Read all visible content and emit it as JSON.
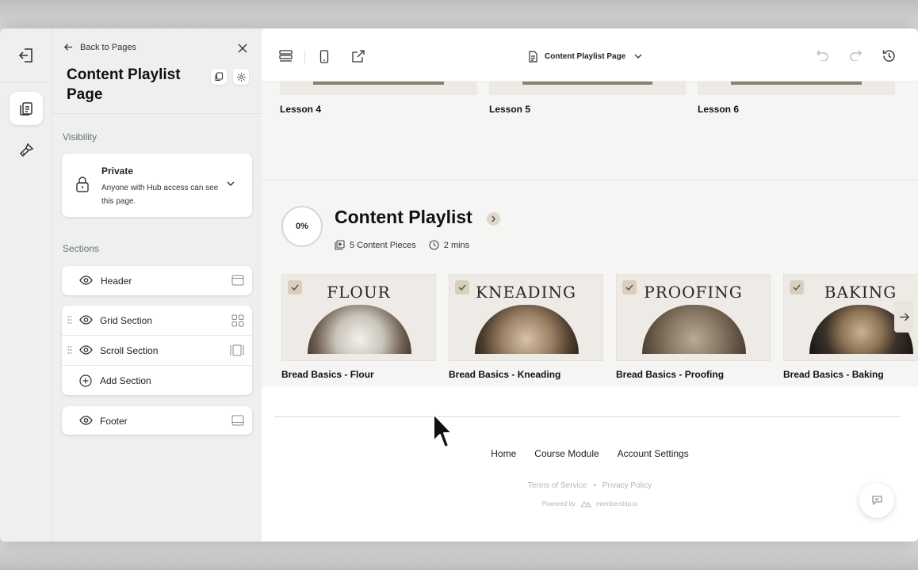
{
  "sidebar": {
    "back_label": "Back to Pages",
    "page_title": "Content Playlist Page",
    "visibility_label": "Visibility",
    "visibility": {
      "title": "Private",
      "description": "Anyone with Hub access can see this page."
    },
    "sections_label": "Sections",
    "sections": {
      "header": "Header",
      "grid": "Grid Section",
      "scroll": "Scroll Section",
      "add": "Add Section",
      "footer": "Footer"
    }
  },
  "toolbar": {
    "page_select": "Content Playlist Page"
  },
  "canvas": {
    "lessons": [
      "Lesson 4",
      "Lesson 5",
      "Lesson 6"
    ],
    "playlist": {
      "progress": "0%",
      "title": "Content Playlist",
      "pieces": "5 Content Pieces",
      "duration": "2 mins"
    },
    "items": [
      {
        "word": "FLOUR",
        "name": "Bread Basics - Flour"
      },
      {
        "word": "KNEADING",
        "name": "Bread Basics - Kneading"
      },
      {
        "word": "PROOFING",
        "name": "Bread Basics - Proofing"
      },
      {
        "word": "BAKING",
        "name": "Bread Basics - Baking"
      }
    ],
    "footer": {
      "links": [
        "Home",
        "Course Module",
        "Account Settings"
      ],
      "terms": "Terms of Service",
      "bullet": "•",
      "privacy": "Privacy Policy",
      "powered_by": "Powered by",
      "brand": "membership.io"
    }
  }
}
